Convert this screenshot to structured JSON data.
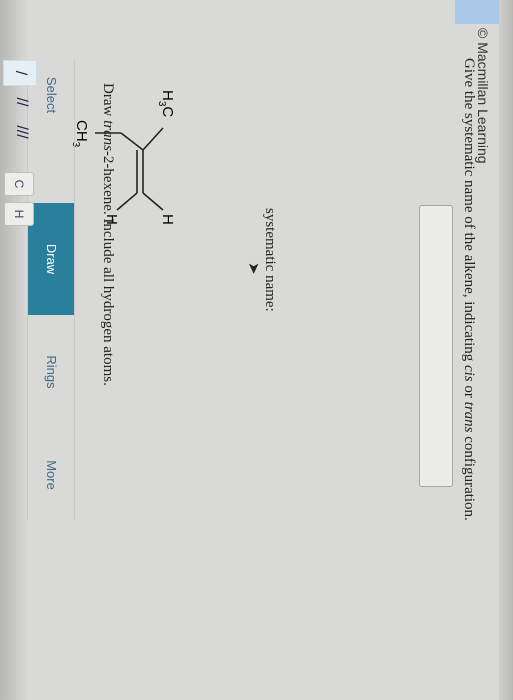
{
  "header": {
    "credit": "© Macmillan Learning"
  },
  "question": {
    "prompt_a": "Give the systematic name of the alkene, indicating ",
    "prompt_cis": "cis",
    "prompt_or": " or ",
    "prompt_trans": "trans",
    "prompt_b": " configuration.",
    "answer_label": "systematic name:",
    "answer_value": ""
  },
  "molecule": {
    "label_h3c": "H",
    "label_h3c_sub": "3",
    "label_h3c_c": "C",
    "label_h_top": "H",
    "label_h_bottom": "H",
    "label_ch3": "CH",
    "label_ch3_sub": "3"
  },
  "draw": {
    "prompt_a": "Draw ",
    "prompt_italic": "trans",
    "prompt_b": "-2-hexene. Include all hydrogen atoms.",
    "tabs": [
      "Select",
      "Draw",
      "Rings",
      "More"
    ],
    "atoms": [
      "C",
      "H"
    ],
    "bonds": [
      "/",
      "//",
      "///"
    ]
  }
}
